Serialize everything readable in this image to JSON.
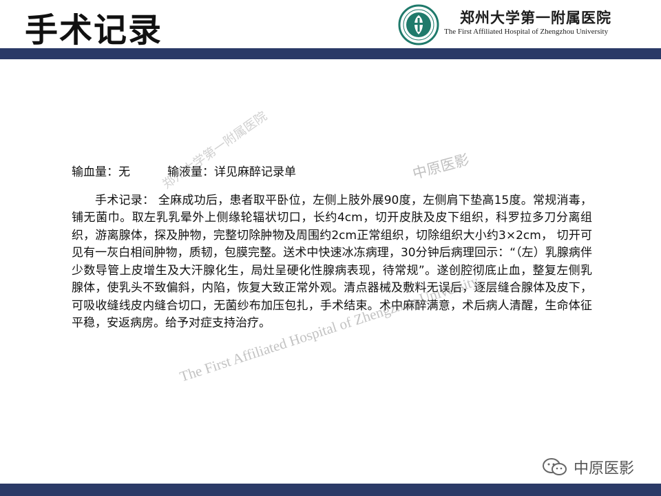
{
  "slide": {
    "title": "手术记录"
  },
  "header": {
    "hospital_name_cn": "郑州大学第一附属医院",
    "hospital_name_en": "The First Affiliated Hospital of Zhengzhou University",
    "logo_icon": "hospital-seal-icon"
  },
  "content": {
    "transfusion_line": "输血量：无          输液量：详见麻醉记录单",
    "record_text": "手术记录：  全麻成功后，患者取平卧位，左侧上肢外展90度，左侧肩下垫高15度。常规消毒，铺无菌巾。取左乳乳晕外上侧缘轮辐状切口，长约4cm，切开皮肤及皮下组织，科罗拉多刀分离组织，游离腺体，探及肿物，完整切除肿物及周围约2cm正常组织，切除组织大小约3×2cm，  切开可见有一灰白相间肿物，质韧，包膜完整。送术中快速冰冻病理，30分钟后病理回示：“（左）乳腺病伴少数导管上皮增生及大汗腺化生，局灶呈硬化性腺病表现，待常规”。遂创腔彻底止血，整复左侧乳腺体，使乳头不致偏斜，内陷，恢复大致正常外观。清点器械及敷料无误后，逐层缝合腺体及皮下，可吸收缝线皮内缝合切口，无菌纱布加压包扎，手术结束。术中麻醉满意，术后病人清醒，生命体征平稳，安返病房。给予对症支持治疗。"
  },
  "watermarks": {
    "top": "中原医影",
    "diagonal": "郑州大学第一附属医院",
    "english": "The First Affiliated Hospital of Zhengzhou University"
  },
  "footer": {
    "wechat_label": "中原医影",
    "wechat_icon": "wechat-icon"
  },
  "colors": {
    "bar": "#2b3a67",
    "logo_green": "#1f7a6b"
  }
}
